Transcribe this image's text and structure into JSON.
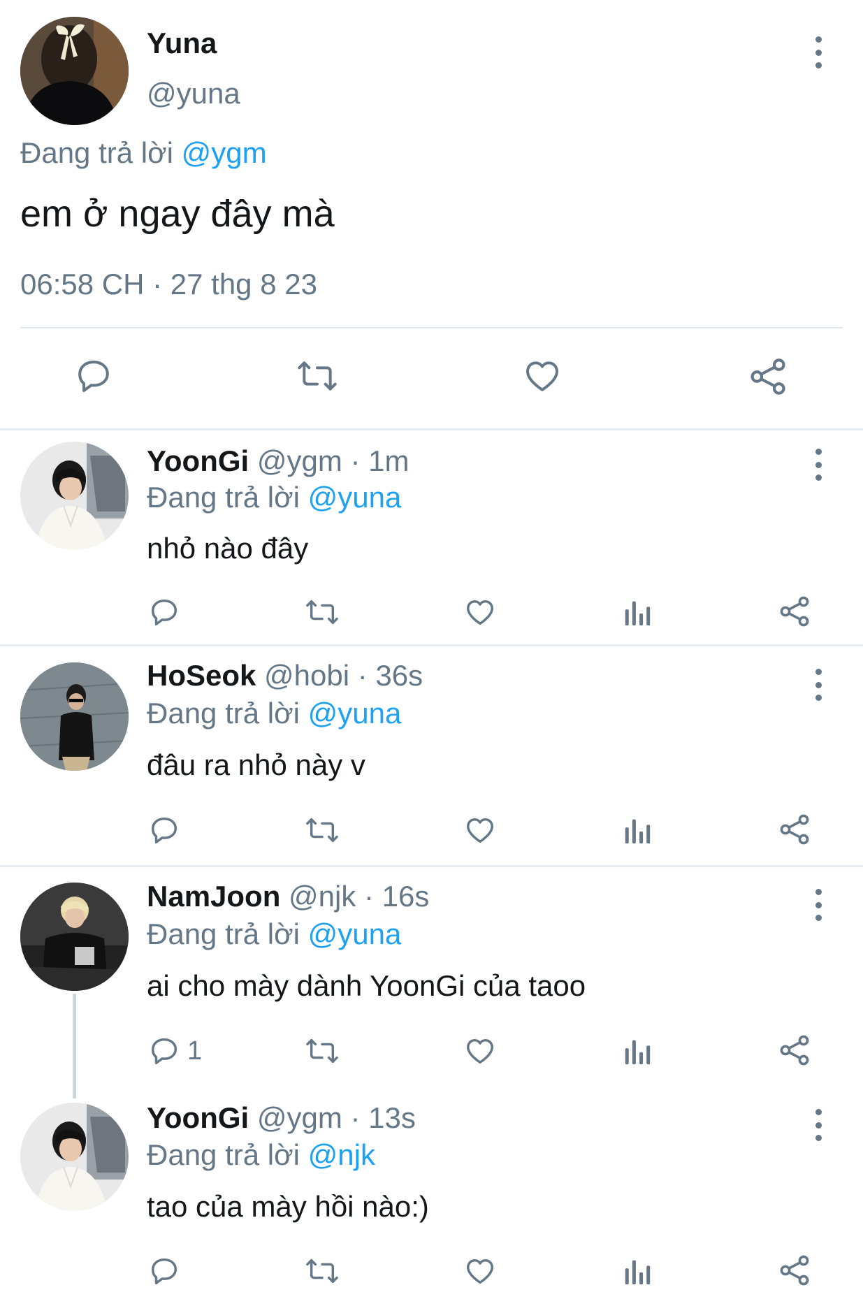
{
  "colors": {
    "text": "#14171a",
    "muted": "#657786",
    "accent": "#1da1f2",
    "divider": "#e1e8ed"
  },
  "main_tweet": {
    "display_name": "Yuna",
    "handle": "@yuna",
    "reply_prefix": "Đang trả lời",
    "reply_to": "@ygm",
    "text": "em ở ngay đây mà",
    "timestamp": "06:58 CH · 27 thg 8 23",
    "actions": [
      "reply-icon",
      "retweet-icon",
      "like-icon",
      "share-icon"
    ]
  },
  "replies": [
    {
      "name": "YoonGi",
      "meta": "@ygm · 1m",
      "reply_prefix": "Đang trả lời",
      "reply_to": "@yuna",
      "text": "nhỏ nào đây",
      "reply_count": ""
    },
    {
      "name": "HoSeok",
      "meta": "@hobi · 36s",
      "reply_prefix": "Đang trả lời",
      "reply_to": "@yuna",
      "text": "đâu ra nhỏ này v",
      "reply_count": ""
    },
    {
      "name": "NamJoon",
      "meta": "@njk · 16s",
      "reply_prefix": "Đang trả lời",
      "reply_to": "@yuna",
      "text": "ai cho mày dành YoonGi của taoo",
      "reply_count": "1"
    },
    {
      "name": "YoonGi",
      "meta": "@ygm · 13s",
      "reply_prefix": "Đang trả lời",
      "reply_to": "@njk",
      "text": "tao của mày hồi nào:)",
      "reply_count": ""
    }
  ]
}
